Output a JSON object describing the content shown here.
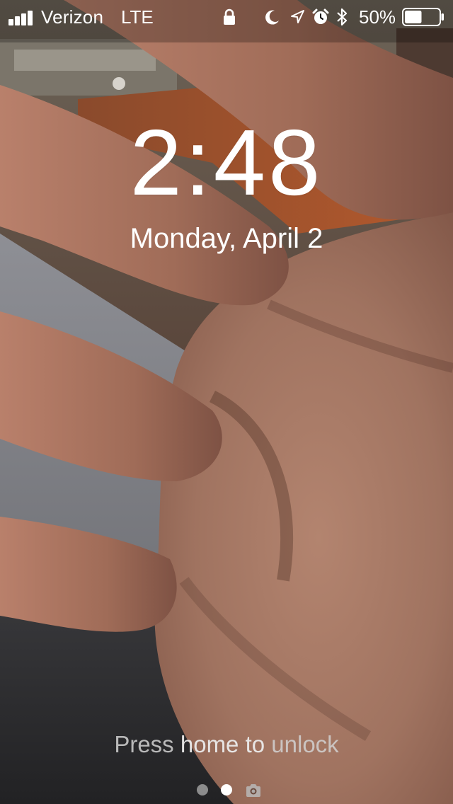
{
  "status_bar": {
    "carrier": "Verizon",
    "network": "LTE",
    "battery_percent": "50%",
    "battery_level": 0.5,
    "icons": [
      "signal-bars-icon",
      "lock-icon",
      "moon-icon",
      "location-arrow-icon",
      "alarm-clock-icon",
      "bluetooth-icon",
      "battery-icon"
    ]
  },
  "lock_screen": {
    "time": "2:48",
    "date": "Monday, April 2",
    "unlock_prompt": "Press home to unlock",
    "unlock_prompt_parts": [
      "Press ",
      "home to",
      " unlock"
    ]
  },
  "page_indicator": {
    "pages": 3,
    "current_page": 2,
    "last_page_icon": "camera-icon"
  },
  "colors": {
    "text": "#ffffff",
    "prompt_text": "#dcdcdc",
    "inactive_dot": "#afafaf"
  }
}
